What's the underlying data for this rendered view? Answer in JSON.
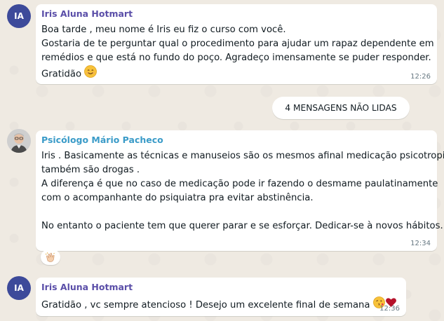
{
  "messages": [
    {
      "avatar_initials": "IA",
      "sender": "Iris Aluna Hotmart",
      "sender_color": "#5a4ea8",
      "lines": [
        "Boa tarde , meu nome é Iris eu fiz o curso com você.",
        "Gostaria de te perguntar qual o procedimento para ajudar um rapaz dependente em",
        "remédios e que está no fundo do poço. Agradeço imensamente se puder responder.",
        "Gratidão"
      ],
      "time": "12:26"
    },
    {
      "sender": "Psicólogo Mário Pacheco",
      "sender_color": "#3a9bc8",
      "lines": [
        "Iris . Basicamente as técnicas e manuseios são os mesmos afinal medicação psicotropica",
        "também são drogas .",
        "A diferença é que no caso de medicação pode ir fazendo o desmame paulatinamente",
        "com o acompanhante do psiquiatra pra evitar abstinência.",
        "",
        "No entanto o paciente tem que querer parar e se esforçar.  Dedicar-se à novos hábitos."
      ],
      "time": "12:34"
    },
    {
      "avatar_initials": "IA",
      "sender": "Iris Aluna Hotmart",
      "sender_color": "#5a4ea8",
      "lines": [
        "Gratidão , vc sempre atencioso ! Desejo um excelente final de semana"
      ],
      "time": "12:36"
    }
  ],
  "unread_label": "4 MENSAGENS NÃO LIDAS",
  "icons": {
    "smiling_emoji": "smiling-face-emoji",
    "reaction": "clapping-hands-emoji",
    "kiss": "face-blowing-kiss-emoji",
    "heart": "red-heart-emoji"
  }
}
